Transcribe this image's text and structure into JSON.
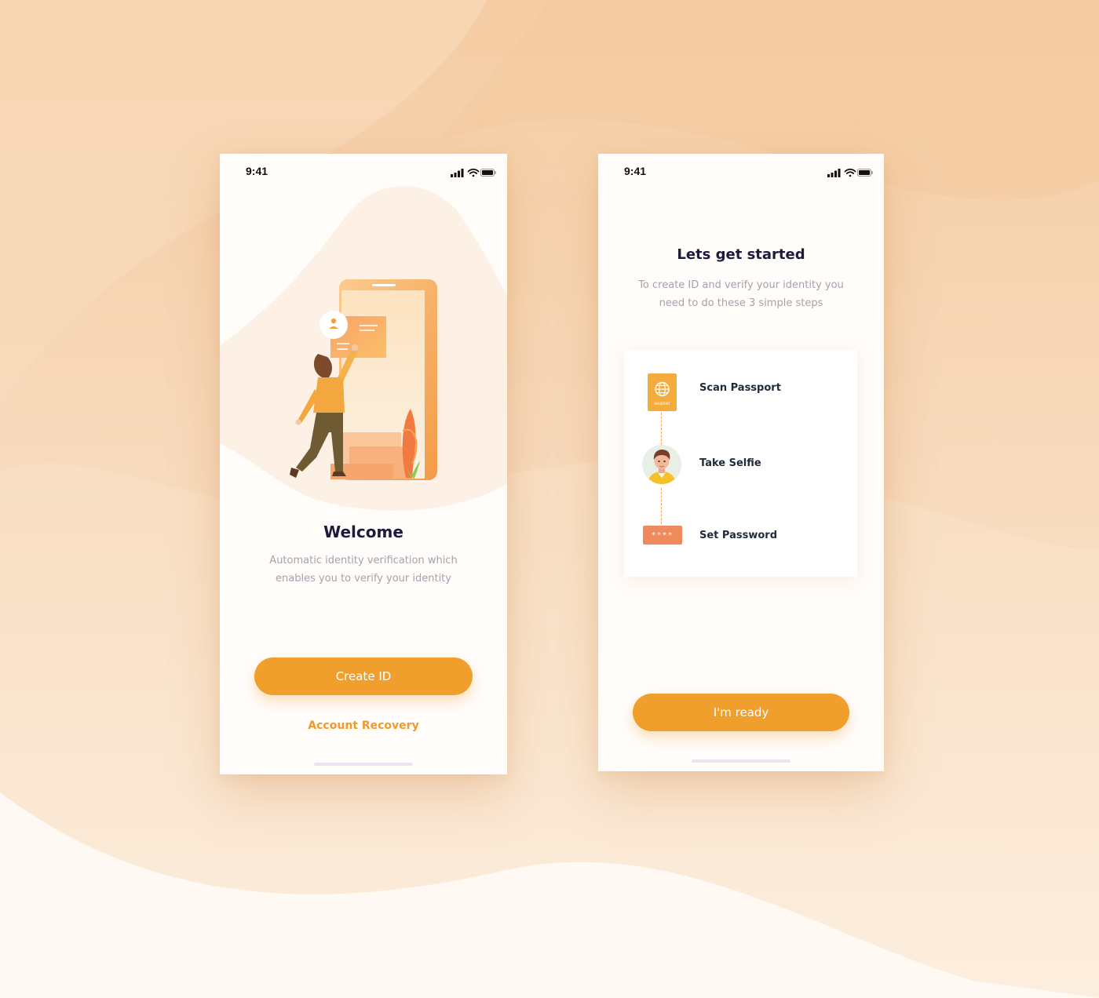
{
  "colors": {
    "accent": "#f09e2c",
    "title": "#1c1a3d",
    "muted": "#a4a3ad",
    "background": "#f6d3ae"
  },
  "screen1": {
    "status_time": "9:41",
    "title": "Welcome",
    "subtitle_line1": "Automatic identity verification which",
    "subtitle_line2": "enables you to verify your identity",
    "primary_button": "Create ID",
    "secondary_link": "Account Recovery"
  },
  "screen2": {
    "status_time": "9:41",
    "title": "Lets get started",
    "subtitle_line1": "To create ID and verify your identity you",
    "subtitle_line2": "need to do these 3 simple steps",
    "steps": [
      {
        "label": "Scan Passport",
        "icon": "passport-icon",
        "icon_caption": "PASSPORT"
      },
      {
        "label": "Take Selfie",
        "icon": "selfie-avatar-icon"
      },
      {
        "label": "Set Password",
        "icon": "password-icon",
        "icon_caption": "****"
      }
    ],
    "primary_button": "I'm ready"
  }
}
